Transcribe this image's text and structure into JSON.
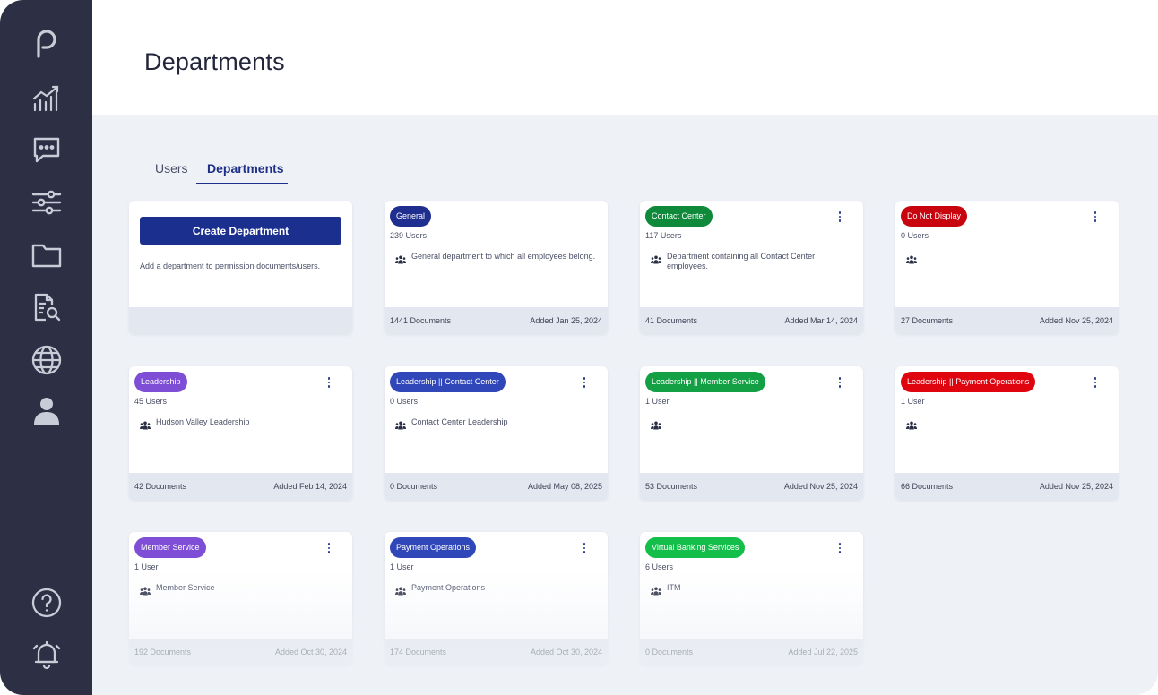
{
  "header": {
    "title": "Departments"
  },
  "tabs": [
    {
      "label": "Users",
      "active": false
    },
    {
      "label": "Departments",
      "active": true
    }
  ],
  "sidebar": {
    "items": [
      {
        "icon": "logo-icon"
      },
      {
        "icon": "analytics-icon"
      },
      {
        "icon": "chat-icon"
      },
      {
        "icon": "sliders-icon"
      },
      {
        "icon": "folder-icon"
      },
      {
        "icon": "document-search-icon"
      },
      {
        "icon": "globe-icon"
      },
      {
        "icon": "user-icon"
      },
      {
        "icon": "help-icon"
      },
      {
        "icon": "bell-icon"
      }
    ]
  },
  "create": {
    "button_label": "Create Department",
    "hint": "Add a department to permission documents/users."
  },
  "departments": [
    {
      "name": "General",
      "color": "#1e2f8f",
      "users": "239 Users",
      "description": "General department to which all employees belong.",
      "documents": "1441 Documents",
      "added": "Added Jan 25, 2024",
      "menu": false
    },
    {
      "name": "Contact Center",
      "color": "#0f8a3a",
      "users": "117 Users",
      "description": "Department containing all Contact Center employees.",
      "documents": "41 Documents",
      "added": "Added Mar 14, 2024",
      "menu": true
    },
    {
      "name": "Do Not Display",
      "color": "#c8050f",
      "users": "0 Users",
      "description": "",
      "documents": "27 Documents",
      "added": "Added Nov 25, 2024",
      "menu": true
    },
    {
      "name": "Leadership",
      "color": "#7e4fd6",
      "users": "45 Users",
      "description": "Hudson Valley Leadership",
      "documents": "42 Documents",
      "added": "Added Feb 14, 2024",
      "menu": true
    },
    {
      "name": "Leadership || Contact Center",
      "color": "#2f47b8",
      "users": "0 Users",
      "description": "Contact Center Leadership",
      "documents": "0 Documents",
      "added": "Added May 08, 2025",
      "menu": true
    },
    {
      "name": "Leadership || Member Service",
      "color": "#13a044",
      "users": "1 User",
      "description": "",
      "documents": "53 Documents",
      "added": "Added Nov 25, 2024",
      "menu": true
    },
    {
      "name": "Leadership || Payment Operations",
      "color": "#e0040f",
      "users": "1 User",
      "description": "",
      "documents": "66 Documents",
      "added": "Added Nov 25, 2024",
      "menu": true
    },
    {
      "name": "Member Service",
      "color": "#7e4fd6",
      "users": "1 User",
      "description": "Member Service",
      "documents": "192 Documents",
      "added": "Added Oct 30, 2024",
      "menu": true
    },
    {
      "name": "Payment Operations",
      "color": "#2f47b8",
      "users": "1 User",
      "description": "Payment Operations",
      "documents": "174 Documents",
      "added": "Added Oct 30, 2024",
      "menu": true
    },
    {
      "name": "Virtual Banking Services",
      "color": "#13bf4a",
      "users": "6 Users",
      "description": "ITM",
      "documents": "0 Documents",
      "added": "Added Jul 22, 2025",
      "menu": true
    }
  ]
}
